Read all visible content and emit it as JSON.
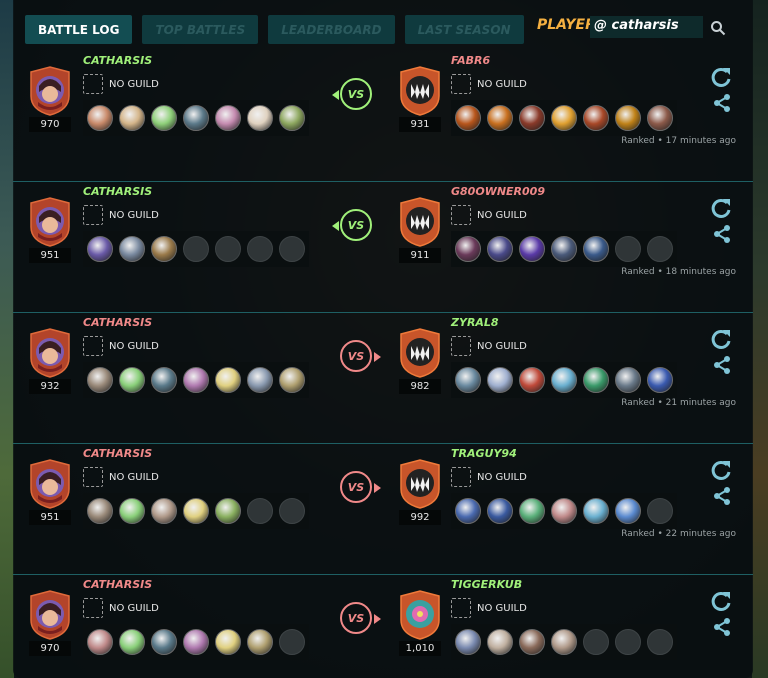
{
  "tabs": [
    {
      "label": "BATTLE LOG",
      "active": true
    },
    {
      "label": "TOP BATTLES",
      "active": false
    },
    {
      "label": "LEADERBOARD",
      "active": false
    },
    {
      "label": "LAST SEASON",
      "active": false
    }
  ],
  "player": {
    "label": "PLAYER:",
    "value": "@ catharsis"
  },
  "colors": {
    "win": "#a0f07a",
    "lose": "#f08989",
    "accent": "#f5b041",
    "tab_active": "#134d52"
  },
  "battles": [
    {
      "vs": "VS",
      "player_won": true,
      "player": {
        "name": "CATHARSIS",
        "guild": "NO GUILD",
        "rating": "970",
        "cards": [
          "#c98a6a",
          "#d4b58a",
          "#8fd07a",
          "#5c7a8a",
          "#c58bb0",
          "#e0d2c0",
          "#8ea860"
        ]
      },
      "opponent": {
        "name": "FABR6",
        "guild": "NO GUILD",
        "rating": "931",
        "cards": [
          "#b8561c",
          "#c9701f",
          "#8a3a2a",
          "#e0a030",
          "#a84828",
          "#c08218",
          "#8c5a4a"
        ]
      },
      "ranked": "Ranked • 17 minutes ago"
    },
    {
      "vs": "VS",
      "player_won": true,
      "player": {
        "name": "CATHARSIS",
        "guild": "NO GUILD",
        "rating": "951",
        "cards": [
          "#6a5aa8",
          "#7a8aa0",
          "#9a7a4a",
          "",
          "",
          "",
          ""
        ]
      },
      "opponent": {
        "name": "G80OWNER009",
        "guild": "NO GUILD",
        "rating": "911",
        "cards": [
          "#6a3a5a",
          "#4a4a8a",
          "#5a3aa8",
          "#4a5a7a",
          "#3a5a8a",
          "",
          ""
        ]
      },
      "ranked": "Ranked • 18 minutes ago"
    },
    {
      "vs": "VS",
      "player_won": false,
      "player": {
        "name": "CATHARSIS",
        "guild": "NO GUILD",
        "rating": "932",
        "cards": [
          "#9a8a7a",
          "#8ad07a",
          "#5a7a8a",
          "#b07ab0",
          "#e0d080",
          "#8a9ab0",
          "#b0a070"
        ]
      },
      "opponent": {
        "name": "ZYRAL8",
        "guild": "NO GUILD",
        "rating": "982",
        "cards": [
          "#6a8aa0",
          "#a0b0d0",
          "#c04a3a",
          "#6ab0d0",
          "#3a9a6a",
          "#6a7a8a",
          "#3a5ab0"
        ]
      },
      "ranked": "Ranked • 21 minutes ago"
    },
    {
      "vs": "VS",
      "player_won": false,
      "player": {
        "name": "CATHARSIS",
        "guild": "NO GUILD",
        "rating": "951",
        "cards": [
          "#9a8a7a",
          "#8ad07a",
          "#b09a8a",
          "#e0d080",
          "#8ab060",
          "",
          ""
        ]
      },
      "opponent": {
        "name": "TRAGUY94",
        "guild": "NO GUILD",
        "rating": "992",
        "cards": [
          "#4a6ab0",
          "#3a5aa0",
          "#5ab07a",
          "#c08a8a",
          "#6ab0d0",
          "#5a8ad0",
          ""
        ]
      },
      "ranked": "Ranked • 22 minutes ago"
    },
    {
      "vs": "VS",
      "player_won": false,
      "player": {
        "name": "CATHARSIS",
        "guild": "NO GUILD",
        "rating": "970",
        "cards": [
          "#c08a8a",
          "#8ad07a",
          "#5a7a8a",
          "#b07ab0",
          "#e0d080",
          "#b0a070",
          ""
        ]
      },
      "opponent": {
        "name": "TIGGERKUB",
        "guild": "NO GUILD",
        "rating": "1,010",
        "cards": [
          "#7a8ab0",
          "#c0b0a0",
          "#8a6a5a",
          "#b09a8a",
          "",
          "",
          ""
        ]
      },
      "ranked": ""
    }
  ]
}
